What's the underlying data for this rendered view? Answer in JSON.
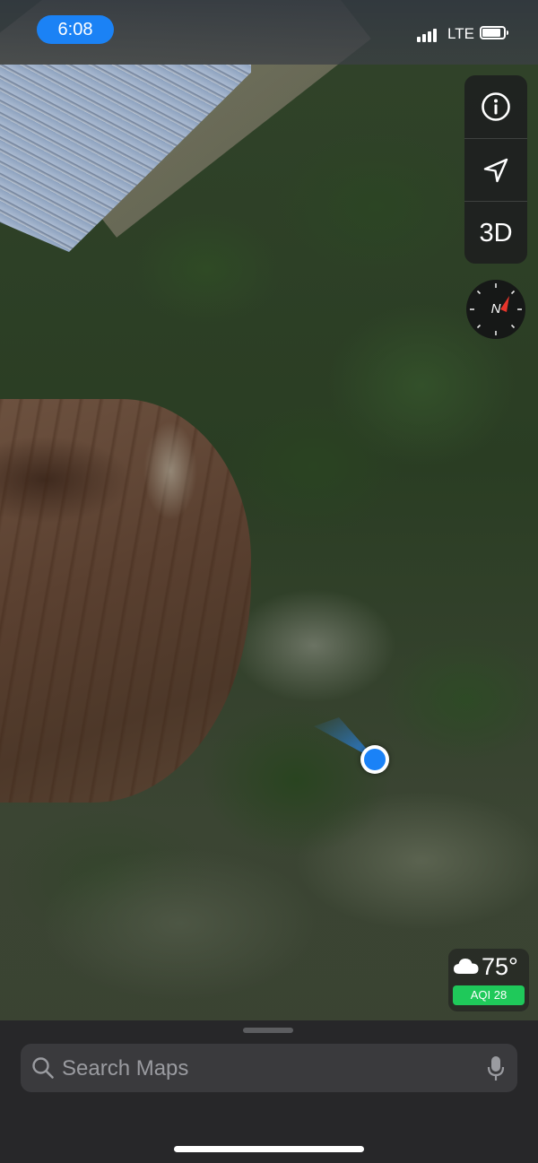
{
  "status_bar": {
    "time": "6:08",
    "network": "LTE",
    "signal_icon": "cellular-signal-icon",
    "battery_icon": "battery-icon"
  },
  "map": {
    "style": "satellite",
    "controls": {
      "info_icon": "info-icon",
      "location_icon": "location-arrow-icon",
      "view_3d_label": "3D",
      "compass_letter": "N"
    },
    "user_location_icon": "user-location-dot-icon"
  },
  "weather": {
    "icon": "cloud-icon",
    "temperature": "75°",
    "aqi_label": "AQI 28",
    "aqi_color": "#1fc95a"
  },
  "search": {
    "placeholder": "Search Maps",
    "icon": "search-icon",
    "mic_icon": "microphone-icon"
  },
  "colors": {
    "accent": "#1b82f5",
    "sheet_background": "#262729"
  }
}
